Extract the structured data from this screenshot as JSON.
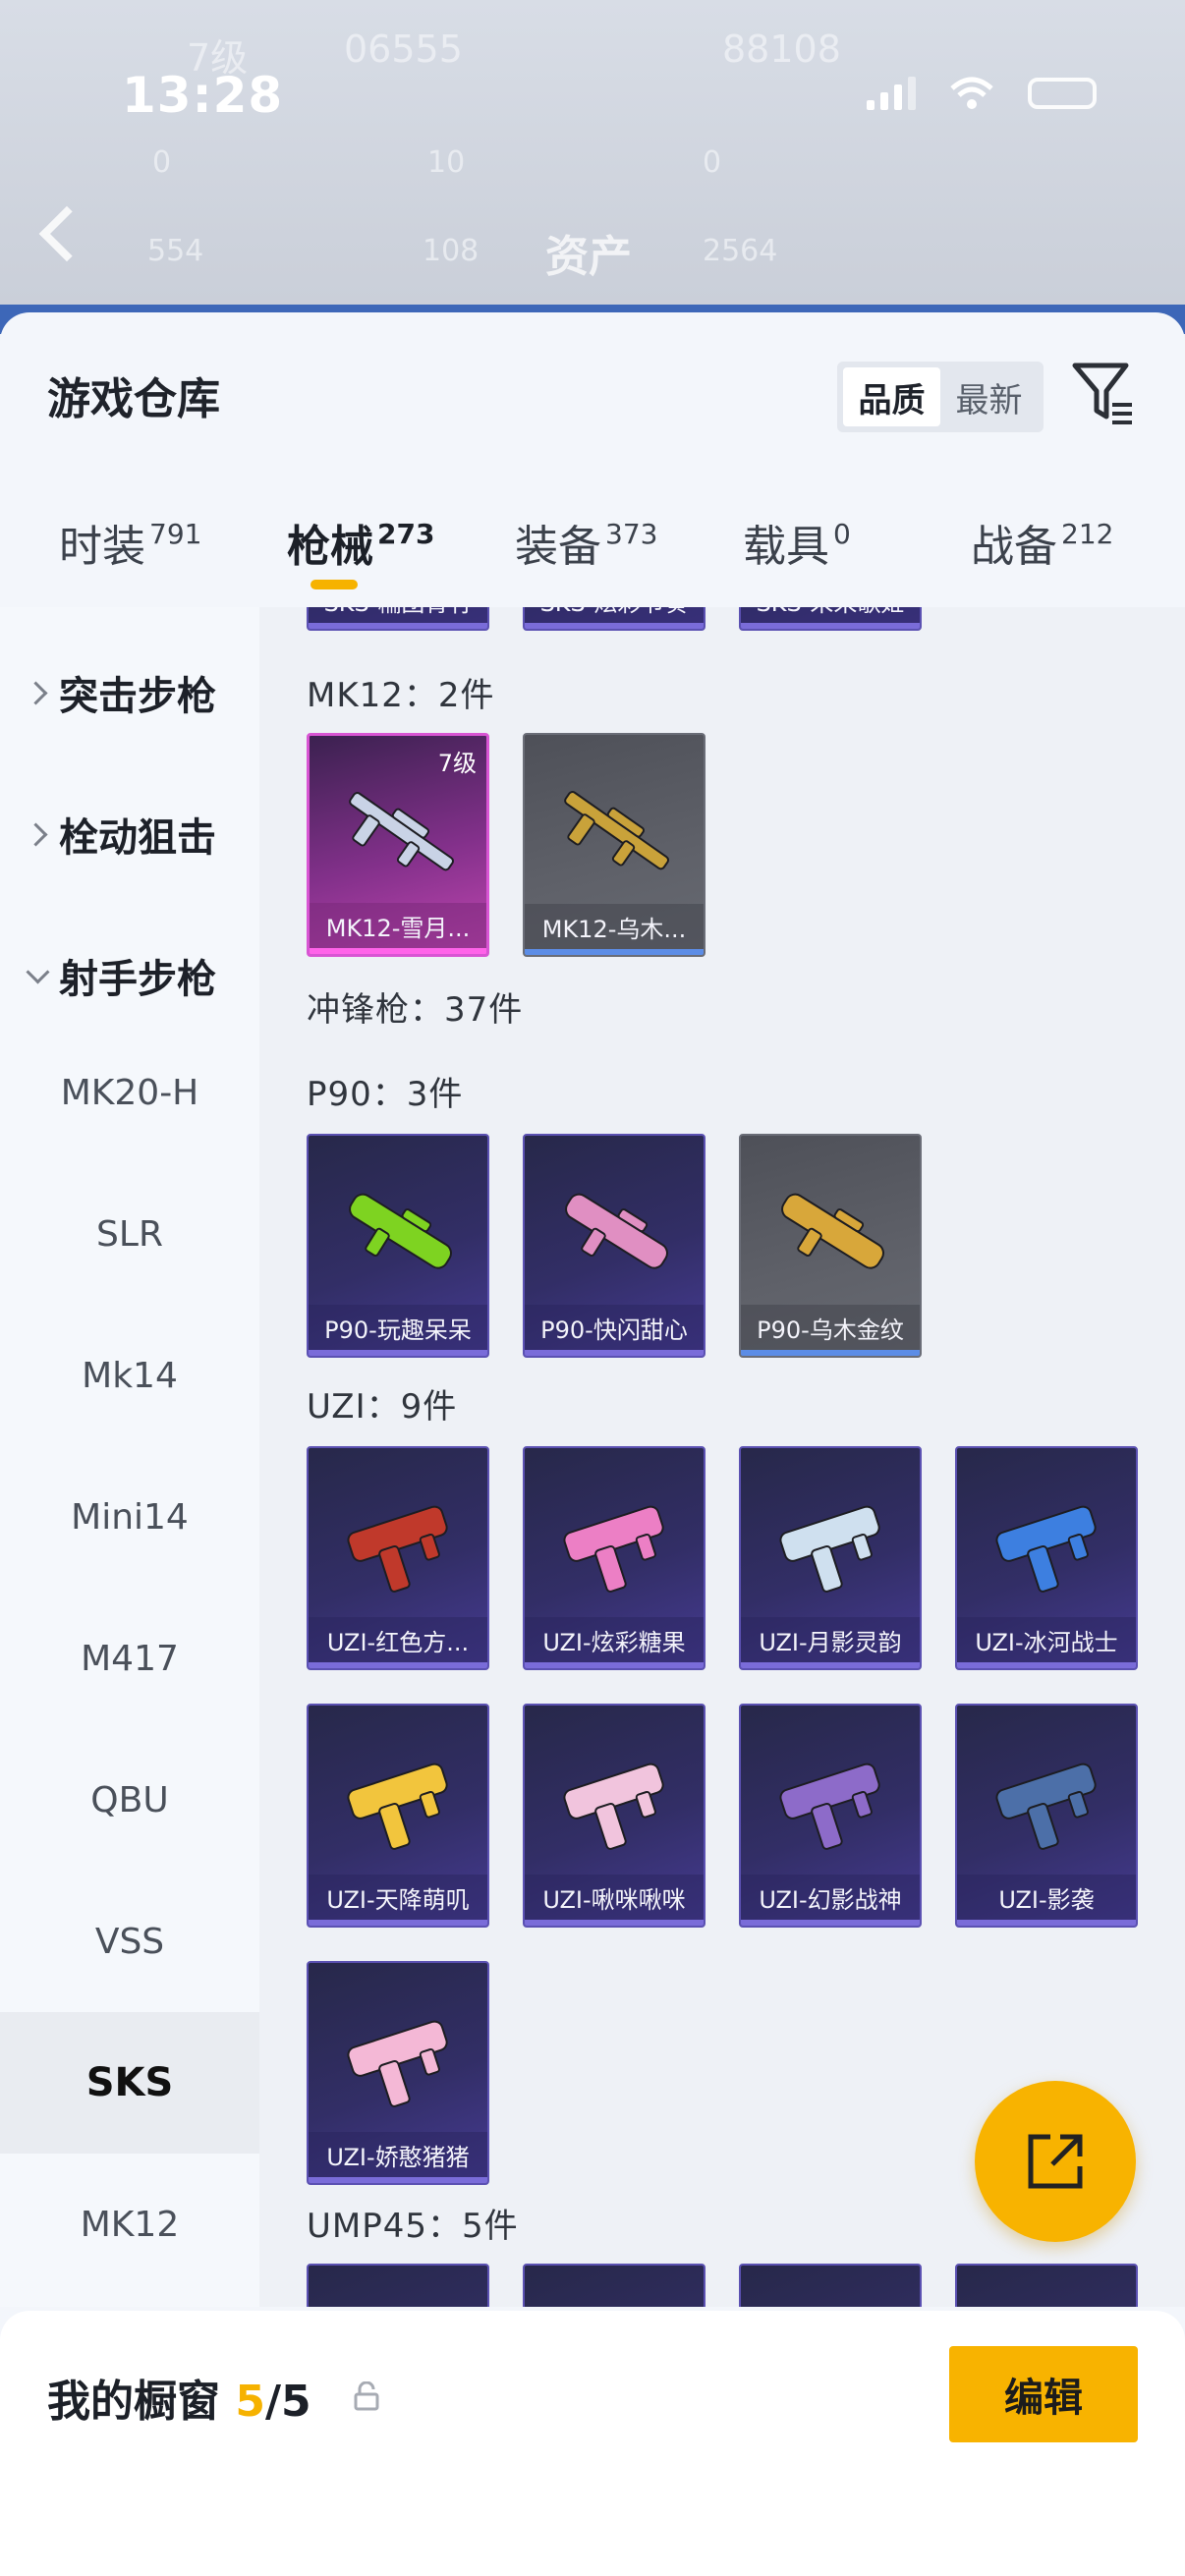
{
  "status_bar": {
    "time": "13:28"
  },
  "backdrop": {
    "title": "资产",
    "values": [
      "7级",
      "06555",
      "88108",
      "0",
      "10",
      "0",
      "554",
      "108",
      "2564"
    ]
  },
  "panel": {
    "title": "游戏仓库",
    "sort": {
      "options": [
        "品质",
        "最新"
      ],
      "active": "品质"
    }
  },
  "tabs": [
    {
      "label": "时装",
      "count": "791"
    },
    {
      "label": "枪械",
      "count": "273",
      "active": true
    },
    {
      "label": "装备",
      "count": "373"
    },
    {
      "label": "载具",
      "count": "0"
    },
    {
      "label": "战备",
      "count": "212"
    }
  ],
  "sidebar": {
    "categories": [
      {
        "label": "突击步枪",
        "expanded": false
      },
      {
        "label": "栓动狙击",
        "expanded": false
      },
      {
        "label": "射手步枪",
        "expanded": true
      }
    ],
    "subitems": [
      "MK20-H",
      "SLR",
      "Mk14",
      "Mini14",
      "M417",
      "QBU",
      "VSS",
      "SKS",
      "MK12"
    ],
    "active_sub": "SKS"
  },
  "content": {
    "top_partial": [
      "SKS-糯团青竹",
      "SKS-炫彩节奏",
      "SKS-未来歌姬"
    ],
    "mk12": {
      "label": "MK12：2件",
      "items": [
        {
          "name": "MK12-雪月...",
          "level": "7级",
          "rarity": "purple",
          "color": "#c9d3e6"
        },
        {
          "name": "MK12-乌木...",
          "rarity": "gray",
          "color": "#c9a23a"
        }
      ]
    },
    "smg_label": "冲锋枪：37件",
    "p90": {
      "label": "P90：3件",
      "items": [
        {
          "name": "P90-玩趣呆呆",
          "rarity": "blue",
          "color": "#7ed321"
        },
        {
          "name": "P90-快闪甜心",
          "rarity": "blue",
          "color": "#e08fc2"
        },
        {
          "name": "P90-乌木金纹",
          "rarity": "gray",
          "color": "#d8a73a"
        }
      ]
    },
    "uzi": {
      "label": "UZI：9件",
      "items": [
        {
          "name": "UZI-红色方...",
          "rarity": "blue",
          "color": "#c0392b"
        },
        {
          "name": "UZI-炫彩糖果",
          "rarity": "blue",
          "color": "#ec7fc5"
        },
        {
          "name": "UZI-月影灵韵",
          "rarity": "blue",
          "color": "#cfe0ef"
        },
        {
          "name": "UZI-冰河战士",
          "rarity": "blue",
          "color": "#3d7fe0"
        },
        {
          "name": "UZI-天降萌叽",
          "rarity": "blue",
          "color": "#f2c53d"
        },
        {
          "name": "UZI-啾咪啾咪",
          "rarity": "blue",
          "color": "#f1c4dd"
        },
        {
          "name": "UZI-幻影战神",
          "rarity": "blue",
          "color": "#8d6bc9"
        },
        {
          "name": "UZI-影袭",
          "rarity": "blue",
          "color": "#4c6fa8"
        },
        {
          "name": "UZI-娇憨猪猪",
          "rarity": "blue",
          "color": "#f4b8d6"
        }
      ]
    },
    "ump45": {
      "label": "UMP45：5件"
    }
  },
  "bottom_bar": {
    "label": "我的橱窗",
    "current": "5",
    "total": "/5",
    "edit": "编辑"
  },
  "colors": {
    "accent": "#f8b300"
  }
}
